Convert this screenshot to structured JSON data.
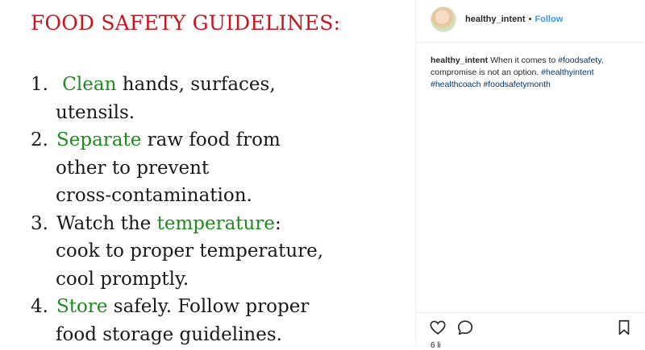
{
  "post_image": {
    "title": "FOOD SAFETY GUIDELINES:",
    "items": [
      {
        "num": "1.",
        "lines": [
          {
            "parts": [
              {
                "t": " Clean",
                "hl": true
              },
              {
                "t": " hands, surfaces,",
                "hl": false
              }
            ]
          },
          {
            "parts": [
              {
                "t": "utensils.",
                "hl": false
              }
            ]
          }
        ]
      },
      {
        "num": "2.",
        "lines": [
          {
            "parts": [
              {
                "t": "Separate",
                "hl": true
              },
              {
                "t": " raw food from",
                "hl": false
              }
            ]
          },
          {
            "parts": [
              {
                "t": "other to prevent",
                "hl": false
              }
            ]
          },
          {
            "parts": [
              {
                "t": "cross-contamination.",
                "hl": false
              }
            ]
          }
        ]
      },
      {
        "num": "3.",
        "lines": [
          {
            "parts": [
              {
                "t": "Watch the ",
                "hl": false
              },
              {
                "t": "temperature",
                "hl": true
              },
              {
                "t": ":",
                "hl": false
              }
            ]
          },
          {
            "parts": [
              {
                "t": "cook to proper temperature,",
                "hl": false
              }
            ]
          },
          {
            "parts": [
              {
                "t": "cool promptly.",
                "hl": false
              }
            ]
          }
        ]
      },
      {
        "num": "4.",
        "lines": [
          {
            "parts": [
              {
                "t": "Store",
                "hl": true
              },
              {
                "t": " safely. Follow proper",
                "hl": false
              }
            ]
          },
          {
            "parts": [
              {
                "t": "food storage guidelines.",
                "hl": false
              }
            ]
          }
        ]
      }
    ],
    "colors": {
      "title": "#c4161c",
      "highlight": "#1f8a1f",
      "text": "#1a1a1a"
    }
  },
  "header": {
    "username": "healthy_intent",
    "separator": "•",
    "follow_label": "Follow"
  },
  "caption": {
    "username": "healthy_intent",
    "text": "When it comes to",
    "tag_food_safety": "#foodsafety",
    "text2": ", compromise is not an option.",
    "tags": [
      "#healthyintent",
      "#healthcoach",
      "#foodsafetymonth"
    ]
  },
  "actions": {
    "icons": [
      "heart-icon",
      "comment-icon",
      "bookmark-icon"
    ]
  },
  "likes_peek": "6 li",
  "colors": {
    "link": "#003569",
    "follow": "#3897f0",
    "text": "#262626"
  }
}
